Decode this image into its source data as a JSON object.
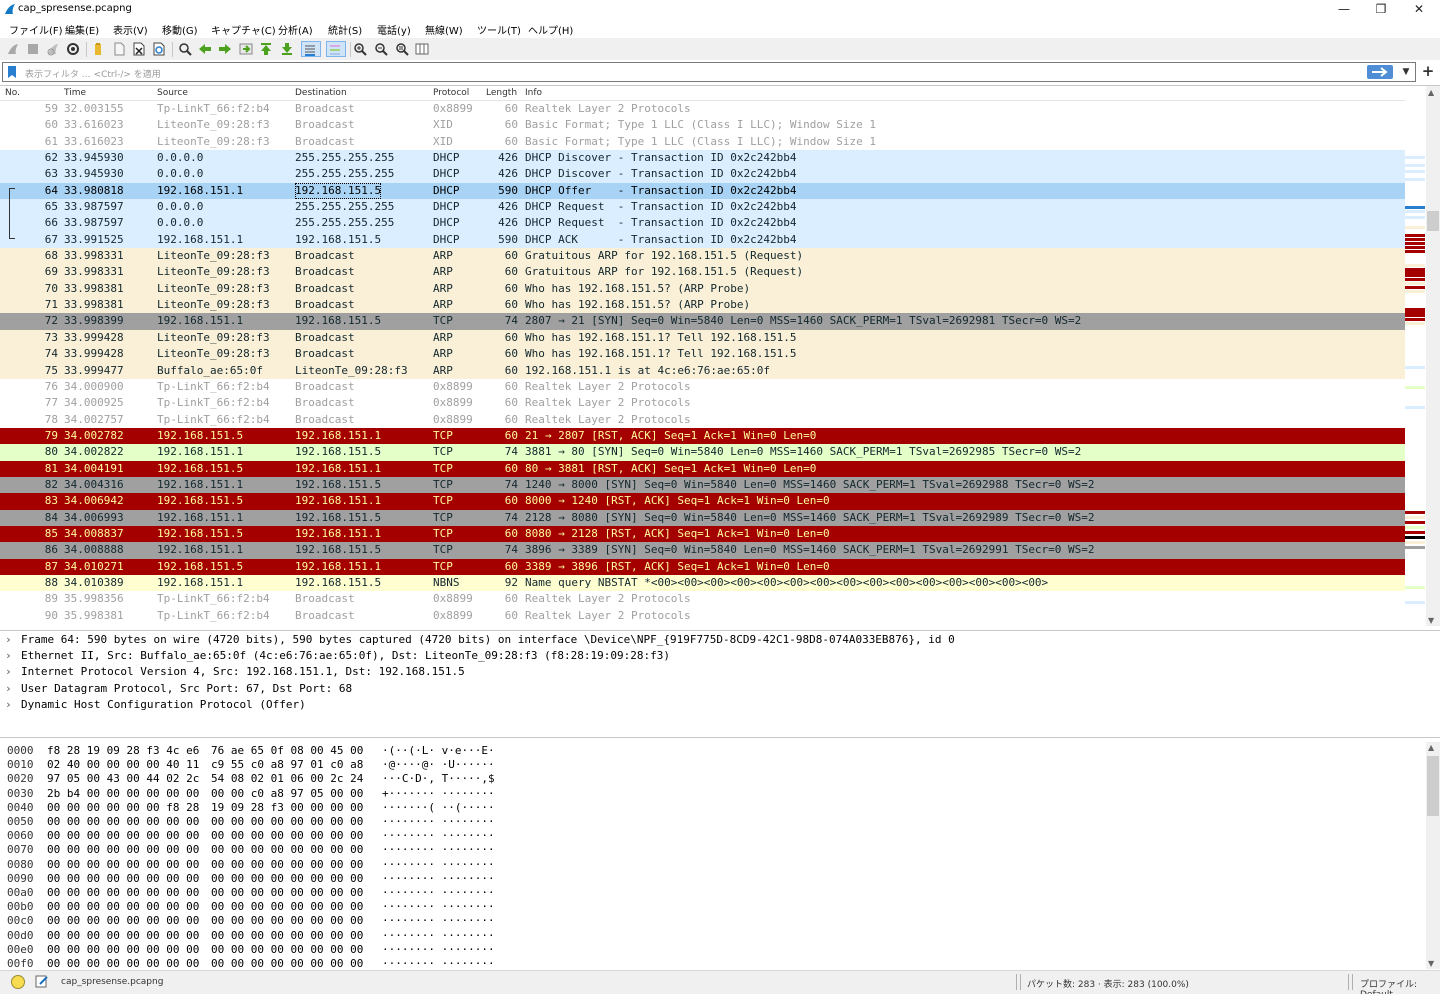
{
  "window": {
    "title": "cap_spresense.pcapng",
    "minimize": "—",
    "maximize": "❐",
    "close": "✕"
  },
  "menu": [
    "ファイル(F)",
    "編集(E)",
    "表示(V)",
    "移動(G)",
    "キャプチャ(C)",
    "分析(A)",
    "統計(S)",
    "電話(y)",
    "無線(W)",
    "ツール(T)",
    "ヘルプ(H)"
  ],
  "toolbar": {
    "icons": [
      "start-capture-icon",
      "stop-capture-icon",
      "restart-capture-icon",
      "capture-options-icon",
      "open-file-icon",
      "save-file-icon",
      "close-file-icon",
      "reload-file-icon",
      "find-packet-icon",
      "go-back-icon",
      "go-forward-icon",
      "go-to-packet-icon",
      "go-first-icon",
      "go-last-icon",
      "autoscroll-icon",
      "colorize-icon",
      "zoom-in-icon",
      "zoom-out-icon",
      "zoom-normal-icon",
      "resize-columns-icon"
    ]
  },
  "filter": {
    "placeholder": "表示フィルタ … <Ctrl-/> を適用",
    "value": ""
  },
  "packet_list": {
    "columns": [
      "No.",
      "Time",
      "Source",
      "Destination",
      "Protocol",
      "Length",
      "Info"
    ],
    "rows": [
      {
        "no": "59",
        "time": "32.003155",
        "src": "Tp-LinkT_66:f2:b4",
        "dst": "Broadcast",
        "proto": "0x8899",
        "len": "60",
        "info": "Realtek Layer 2 Protocols",
        "bg": "#ffffff",
        "fg": "#a0a0a0"
      },
      {
        "no": "60",
        "time": "33.616023",
        "src": "LiteonTe_09:28:f3",
        "dst": "Broadcast",
        "proto": "XID",
        "len": "60",
        "info": "Basic Format; Type 1 LLC (Class I LLC); Window Size 1",
        "bg": "#ffffff",
        "fg": "#a0a0a0"
      },
      {
        "no": "61",
        "time": "33.616023",
        "src": "LiteonTe_09:28:f3",
        "dst": "Broadcast",
        "proto": "XID",
        "len": "60",
        "info": "Basic Format; Type 1 LLC (Class I LLC); Window Size 1",
        "bg": "#ffffff",
        "fg": "#a0a0a0"
      },
      {
        "no": "62",
        "time": "33.945930",
        "src": "0.0.0.0",
        "dst": "255.255.255.255",
        "proto": "DHCP",
        "len": "426",
        "info": "DHCP Discover - Transaction ID 0x2c242bb4",
        "bg": "#daeeff",
        "fg": "#12272e"
      },
      {
        "no": "63",
        "time": "33.945930",
        "src": "0.0.0.0",
        "dst": "255.255.255.255",
        "proto": "DHCP",
        "len": "426",
        "info": "DHCP Discover - Transaction ID 0x2c242bb4",
        "bg": "#daeeff",
        "fg": "#12272e"
      },
      {
        "no": "64",
        "time": "33.980818",
        "src": "192.168.151.1",
        "dst": "192.168.151.5",
        "proto": "DHCP",
        "len": "590",
        "info": "DHCP Offer    - Transaction ID 0x2c242bb4",
        "bg": "#a8d3f5",
        "fg": "#000000",
        "selected": true
      },
      {
        "no": "65",
        "time": "33.987597",
        "src": "0.0.0.0",
        "dst": "255.255.255.255",
        "proto": "DHCP",
        "len": "426",
        "info": "DHCP Request  - Transaction ID 0x2c242bb4",
        "bg": "#daeeff",
        "fg": "#12272e"
      },
      {
        "no": "66",
        "time": "33.987597",
        "src": "0.0.0.0",
        "dst": "255.255.255.255",
        "proto": "DHCP",
        "len": "426",
        "info": "DHCP Request  - Transaction ID 0x2c242bb4",
        "bg": "#daeeff",
        "fg": "#12272e"
      },
      {
        "no": "67",
        "time": "33.991525",
        "src": "192.168.151.1",
        "dst": "192.168.151.5",
        "proto": "DHCP",
        "len": "590",
        "info": "DHCP ACK      - Transaction ID 0x2c242bb4",
        "bg": "#daeeff",
        "fg": "#12272e"
      },
      {
        "no": "68",
        "time": "33.998331",
        "src": "LiteonTe_09:28:f3",
        "dst": "Broadcast",
        "proto": "ARP",
        "len": "60",
        "info": "Gratuitous ARP for 192.168.151.5 (Request)",
        "bg": "#faf0d7",
        "fg": "#12272e"
      },
      {
        "no": "69",
        "time": "33.998331",
        "src": "LiteonTe_09:28:f3",
        "dst": "Broadcast",
        "proto": "ARP",
        "len": "60",
        "info": "Gratuitous ARP for 192.168.151.5 (Request)",
        "bg": "#faf0d7",
        "fg": "#12272e"
      },
      {
        "no": "70",
        "time": "33.998381",
        "src": "LiteonTe_09:28:f3",
        "dst": "Broadcast",
        "proto": "ARP",
        "len": "60",
        "info": "Who has 192.168.151.5? (ARP Probe)",
        "bg": "#faf0d7",
        "fg": "#12272e"
      },
      {
        "no": "71",
        "time": "33.998381",
        "src": "LiteonTe_09:28:f3",
        "dst": "Broadcast",
        "proto": "ARP",
        "len": "60",
        "info": "Who has 192.168.151.5? (ARP Probe)",
        "bg": "#faf0d7",
        "fg": "#12272e"
      },
      {
        "no": "72",
        "time": "33.998399",
        "src": "192.168.151.1",
        "dst": "192.168.151.5",
        "proto": "TCP",
        "len": "74",
        "info": "2807 → 21 [SYN] Seq=0 Win=5840 Len=0 MSS=1460 SACK_PERM=1 TSval=2692981 TSecr=0 WS=2",
        "bg": "#a0a0a0",
        "fg": "#12272e"
      },
      {
        "no": "73",
        "time": "33.999428",
        "src": "LiteonTe_09:28:f3",
        "dst": "Broadcast",
        "proto": "ARP",
        "len": "60",
        "info": "Who has 192.168.151.1? Tell 192.168.151.5",
        "bg": "#faf0d7",
        "fg": "#12272e"
      },
      {
        "no": "74",
        "time": "33.999428",
        "src": "LiteonTe_09:28:f3",
        "dst": "Broadcast",
        "proto": "ARP",
        "len": "60",
        "info": "Who has 192.168.151.1? Tell 192.168.151.5",
        "bg": "#faf0d7",
        "fg": "#12272e"
      },
      {
        "no": "75",
        "time": "33.999477",
        "src": "Buffalo_ae:65:0f",
        "dst": "LiteonTe_09:28:f3",
        "proto": "ARP",
        "len": "60",
        "info": "192.168.151.1 is at 4c:e6:76:ae:65:0f",
        "bg": "#faf0d7",
        "fg": "#12272e"
      },
      {
        "no": "76",
        "time": "34.000900",
        "src": "Tp-LinkT_66:f2:b4",
        "dst": "Broadcast",
        "proto": "0x8899",
        "len": "60",
        "info": "Realtek Layer 2 Protocols",
        "bg": "#ffffff",
        "fg": "#a0a0a0"
      },
      {
        "no": "77",
        "time": "34.000925",
        "src": "Tp-LinkT_66:f2:b4",
        "dst": "Broadcast",
        "proto": "0x8899",
        "len": "60",
        "info": "Realtek Layer 2 Protocols",
        "bg": "#ffffff",
        "fg": "#a0a0a0"
      },
      {
        "no": "78",
        "time": "34.002757",
        "src": "Tp-LinkT_66:f2:b4",
        "dst": "Broadcast",
        "proto": "0x8899",
        "len": "60",
        "info": "Realtek Layer 2 Protocols",
        "bg": "#ffffff",
        "fg": "#a0a0a0"
      },
      {
        "no": "79",
        "time": "34.002782",
        "src": "192.168.151.5",
        "dst": "192.168.151.1",
        "proto": "TCP",
        "len": "60",
        "info": "21 → 2807 [RST, ACK] Seq=1 Ack=1 Win=0 Len=0",
        "bg": "#a40000",
        "fg": "#fffc9c"
      },
      {
        "no": "80",
        "time": "34.002822",
        "src": "192.168.151.1",
        "dst": "192.168.151.5",
        "proto": "TCP",
        "len": "74",
        "info": "3881 → 80 [SYN] Seq=0 Win=5840 Len=0 MSS=1460 SACK_PERM=1 TSval=2692985 TSecr=0 WS=2",
        "bg": "#e4ffc7",
        "fg": "#12272e"
      },
      {
        "no": "81",
        "time": "34.004191",
        "src": "192.168.151.5",
        "dst": "192.168.151.1",
        "proto": "TCP",
        "len": "60",
        "info": "80 → 3881 [RST, ACK] Seq=1 Ack=1 Win=0 Len=0",
        "bg": "#a40000",
        "fg": "#fffc9c"
      },
      {
        "no": "82",
        "time": "34.004316",
        "src": "192.168.151.1",
        "dst": "192.168.151.5",
        "proto": "TCP",
        "len": "74",
        "info": "1240 → 8000 [SYN] Seq=0 Win=5840 Len=0 MSS=1460 SACK_PERM=1 TSval=2692988 TSecr=0 WS=2",
        "bg": "#a0a0a0",
        "fg": "#12272e"
      },
      {
        "no": "83",
        "time": "34.006942",
        "src": "192.168.151.5",
        "dst": "192.168.151.1",
        "proto": "TCP",
        "len": "60",
        "info": "8000 → 1240 [RST, ACK] Seq=1 Ack=1 Win=0 Len=0",
        "bg": "#a40000",
        "fg": "#fffc9c"
      },
      {
        "no": "84",
        "time": "34.006993",
        "src": "192.168.151.1",
        "dst": "192.168.151.5",
        "proto": "TCP",
        "len": "74",
        "info": "2128 → 8080 [SYN] Seq=0 Win=5840 Len=0 MSS=1460 SACK_PERM=1 TSval=2692989 TSecr=0 WS=2",
        "bg": "#a0a0a0",
        "fg": "#12272e"
      },
      {
        "no": "85",
        "time": "34.008837",
        "src": "192.168.151.5",
        "dst": "192.168.151.1",
        "proto": "TCP",
        "len": "60",
        "info": "8080 → 2128 [RST, ACK] Seq=1 Ack=1 Win=0 Len=0",
        "bg": "#a40000",
        "fg": "#fffc9c"
      },
      {
        "no": "86",
        "time": "34.008888",
        "src": "192.168.151.1",
        "dst": "192.168.151.5",
        "proto": "TCP",
        "len": "74",
        "info": "3896 → 3389 [SYN] Seq=0 Win=5840 Len=0 MSS=1460 SACK_PERM=1 TSval=2692991 TSecr=0 WS=2",
        "bg": "#a0a0a0",
        "fg": "#12272e"
      },
      {
        "no": "87",
        "time": "34.010271",
        "src": "192.168.151.5",
        "dst": "192.168.151.1",
        "proto": "TCP",
        "len": "60",
        "info": "3389 → 3896 [RST, ACK] Seq=1 Ack=1 Win=0 Len=0",
        "bg": "#a40000",
        "fg": "#fffc9c"
      },
      {
        "no": "88",
        "time": "34.010389",
        "src": "192.168.151.1",
        "dst": "192.168.151.5",
        "proto": "NBNS",
        "len": "92",
        "info": "Name query NBSTAT *<00><00><00><00><00><00><00><00><00><00><00><00><00><00><00>",
        "bg": "#fefed0",
        "fg": "#12272e"
      },
      {
        "no": "89",
        "time": "35.998356",
        "src": "Tp-LinkT_66:f2:b4",
        "dst": "Broadcast",
        "proto": "0x8899",
        "len": "60",
        "info": "Realtek Layer 2 Protocols",
        "bg": "#ffffff",
        "fg": "#a0a0a0"
      },
      {
        "no": "90",
        "time": "35.998381",
        "src": "Tp-LinkT_66:f2:b4",
        "dst": "Broadcast",
        "proto": "0x8899",
        "len": "60",
        "info": "Realtek Layer 2 Protocols",
        "bg": "#ffffff",
        "fg": "#a0a0a0"
      }
    ]
  },
  "details": [
    "Frame 64: 590 bytes on wire (4720 bits), 590 bytes captured (4720 bits) on interface \\Device\\NPF_{919F775D-8CD9-42C1-98D8-074A033EB876}, id 0",
    "Ethernet II, Src: Buffalo_ae:65:0f (4c:e6:76:ae:65:0f), Dst: LiteonTe_09:28:f3 (f8:28:19:09:28:f3)",
    "Internet Protocol Version 4, Src: 192.168.151.1, Dst: 192.168.151.5",
    "User Datagram Protocol, Src Port: 67, Dst Port: 68",
    "Dynamic Host Configuration Protocol (Offer)"
  ],
  "bytes": [
    {
      "off": "0000",
      "h1": "f8 28 19 09 28 f3 4c e6",
      "h2": "76 ae 65 0f 08 00 45 00",
      "asc": "·(··(·L· v·e···E·"
    },
    {
      "off": "0010",
      "h1": "02 40 00 00 00 00 40 11",
      "h2": "c9 55 c0 a8 97 01 c0 a8",
      "asc": "·@····@· ·U······"
    },
    {
      "off": "0020",
      "h1": "97 05 00 43 00 44 02 2c",
      "h2": "54 08 02 01 06 00 2c 24",
      "asc": "···C·D·, T·····,$"
    },
    {
      "off": "0030",
      "h1": "2b b4 00 00 00 00 00 00",
      "h2": "00 00 c0 a8 97 05 00 00",
      "asc": "+······· ········"
    },
    {
      "off": "0040",
      "h1": "00 00 00 00 00 00 f8 28",
      "h2": "19 09 28 f3 00 00 00 00",
      "asc": "·······( ··(·····"
    },
    {
      "off": "0050",
      "h1": "00 00 00 00 00 00 00 00",
      "h2": "00 00 00 00 00 00 00 00",
      "asc": "········ ········"
    },
    {
      "off": "0060",
      "h1": "00 00 00 00 00 00 00 00",
      "h2": "00 00 00 00 00 00 00 00",
      "asc": "········ ········"
    },
    {
      "off": "0070",
      "h1": "00 00 00 00 00 00 00 00",
      "h2": "00 00 00 00 00 00 00 00",
      "asc": "········ ········"
    },
    {
      "off": "0080",
      "h1": "00 00 00 00 00 00 00 00",
      "h2": "00 00 00 00 00 00 00 00",
      "asc": "········ ········"
    },
    {
      "off": "0090",
      "h1": "00 00 00 00 00 00 00 00",
      "h2": "00 00 00 00 00 00 00 00",
      "asc": "········ ········"
    },
    {
      "off": "00a0",
      "h1": "00 00 00 00 00 00 00 00",
      "h2": "00 00 00 00 00 00 00 00",
      "asc": "········ ········"
    },
    {
      "off": "00b0",
      "h1": "00 00 00 00 00 00 00 00",
      "h2": "00 00 00 00 00 00 00 00",
      "asc": "········ ········"
    },
    {
      "off": "00c0",
      "h1": "00 00 00 00 00 00 00 00",
      "h2": "00 00 00 00 00 00 00 00",
      "asc": "········ ········"
    },
    {
      "off": "00d0",
      "h1": "00 00 00 00 00 00 00 00",
      "h2": "00 00 00 00 00 00 00 00",
      "asc": "········ ········"
    },
    {
      "off": "00e0",
      "h1": "00 00 00 00 00 00 00 00",
      "h2": "00 00 00 00 00 00 00 00",
      "asc": "········ ········"
    },
    {
      "off": "00f0",
      "h1": "00 00 00 00 00 00 00 00",
      "h2": "00 00 00 00 00 00 00 00",
      "asc": "········ ········"
    }
  ],
  "status": {
    "file": "cap_spresense.pcapng",
    "packets": "パケット数: 283 · 表示: 283 (100.0%)",
    "profile": "プロファイル: Default"
  },
  "colors": {
    "accent": "#4f8ed6",
    "selected_row": "#a8d3f5",
    "rst_row": "#a40000",
    "syn_row": "#a0a0a0",
    "dhcp_row": "#daeeff",
    "arp_row": "#faf0d7",
    "nbns_row": "#fefed0"
  }
}
